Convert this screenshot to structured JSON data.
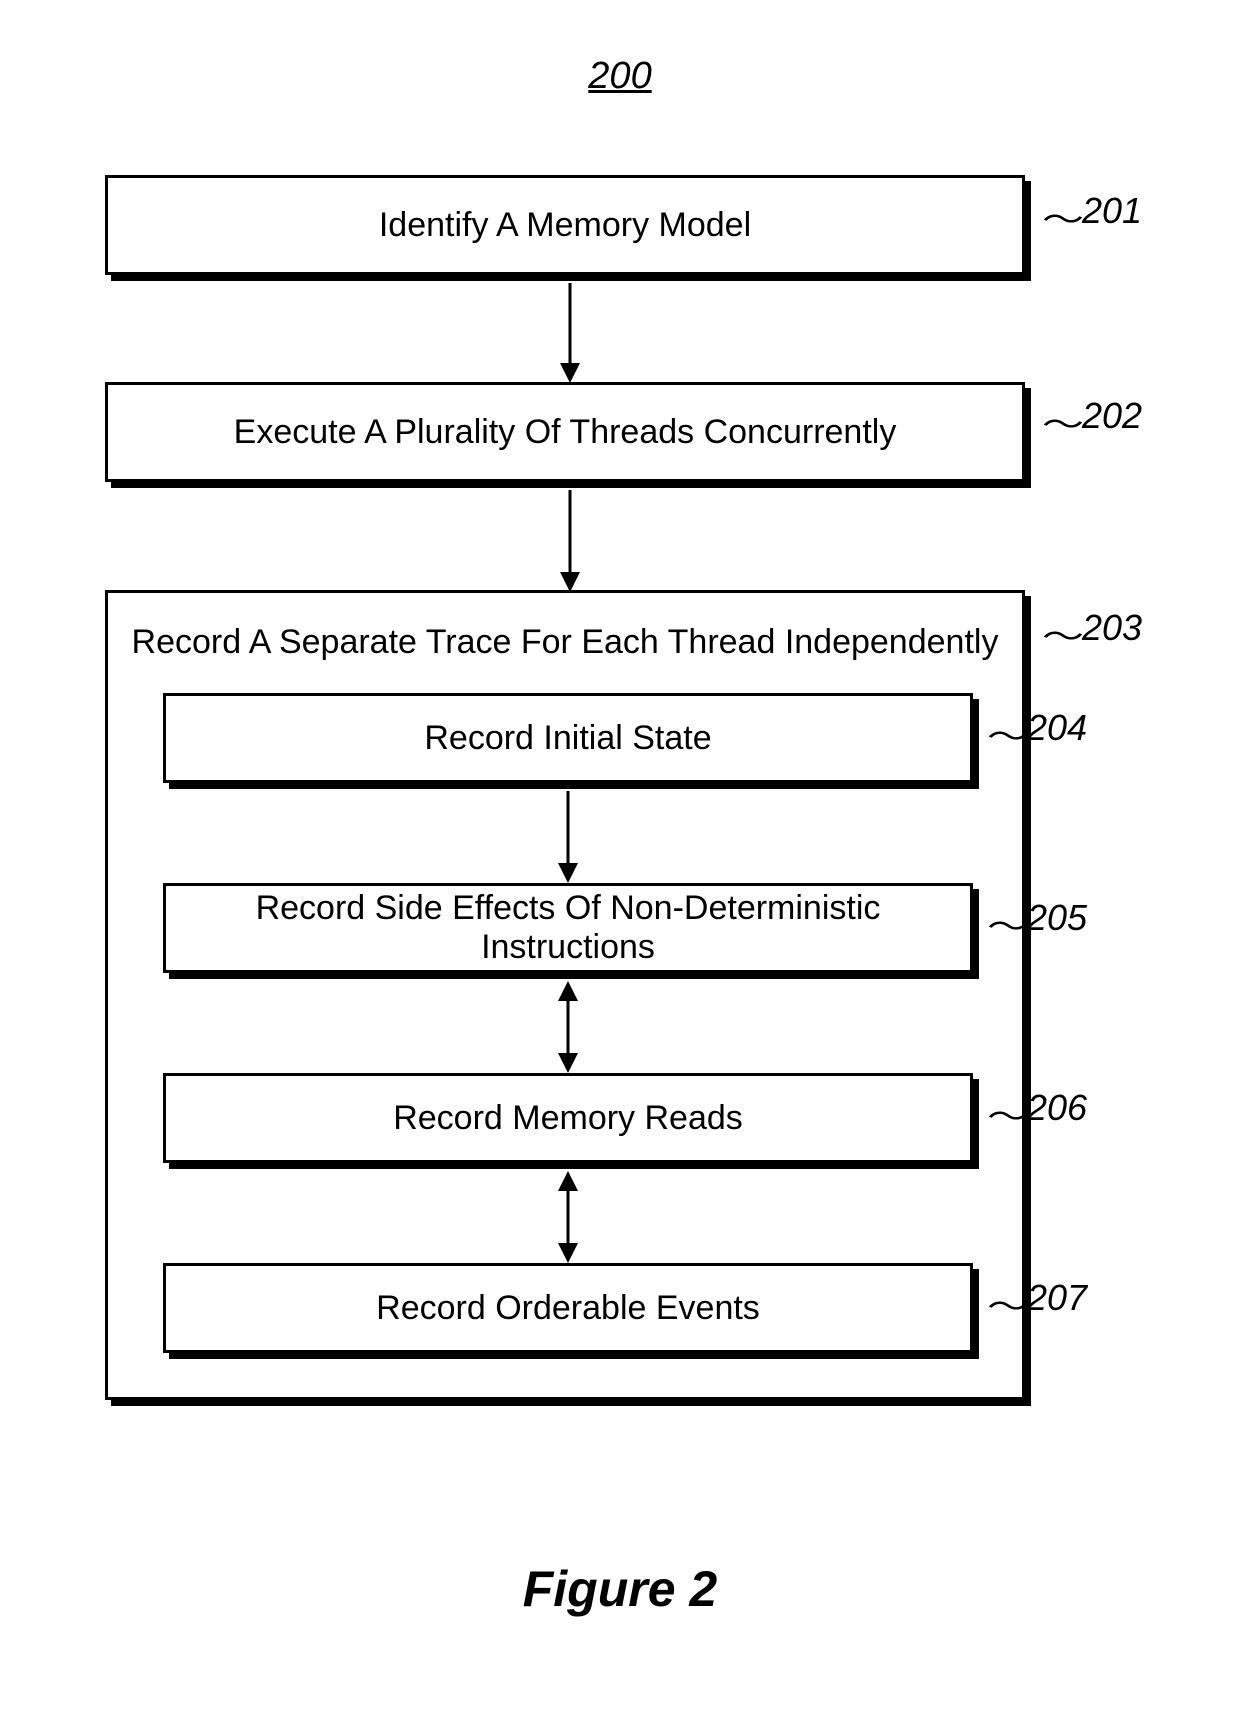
{
  "figure_number": "200",
  "figure_caption": "Figure 2",
  "boxes": {
    "b201": {
      "label": "Identify A Memory Model",
      "ref": "201"
    },
    "b202": {
      "label": "Execute A Plurality Of Threads Concurrently",
      "ref": "202"
    },
    "b203": {
      "label": "Record A Separate Trace For Each Thread Independently",
      "ref": "203"
    },
    "b204": {
      "label": "Record Initial State",
      "ref": "204"
    },
    "b205": {
      "label": "Record Side Effects Of Non-Deterministic Instructions",
      "ref": "205"
    },
    "b206": {
      "label": "Record Memory Reads",
      "ref": "206"
    },
    "b207": {
      "label": "Record Orderable Events",
      "ref": "207"
    }
  }
}
